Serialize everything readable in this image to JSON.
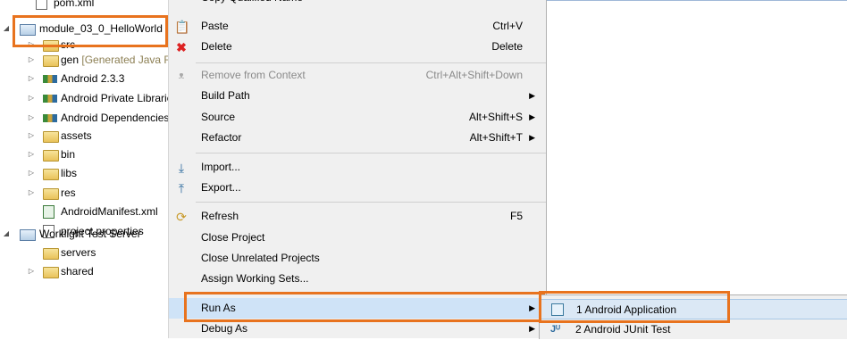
{
  "tree": {
    "items": [
      {
        "label": "pom.xml"
      },
      {
        "label": "module_03_0_HelloWorld"
      },
      {
        "label": "src"
      },
      {
        "label": "gen",
        "suffix": "[Generated Java Files]"
      },
      {
        "label": "Android 2.3.3"
      },
      {
        "label": "Android Private Libraries"
      },
      {
        "label": "Android Dependencies"
      },
      {
        "label": "assets"
      },
      {
        "label": "bin"
      },
      {
        "label": "libs"
      },
      {
        "label": "res"
      },
      {
        "label": "AndroidManifest.xml"
      },
      {
        "label": "project.properties"
      },
      {
        "label": "Worklight Test Server"
      },
      {
        "label": "servers"
      },
      {
        "label": "shared"
      }
    ]
  },
  "menu": {
    "top_partial": "Copy Qualified Name",
    "items": [
      {
        "label": "Paste",
        "accel": "Ctrl+V"
      },
      {
        "label": "Delete",
        "accel": "Delete"
      },
      {
        "label": "Remove from Context",
        "accel": "Ctrl+Alt+Shift+Down"
      },
      {
        "label": "Build Path",
        "accel": ""
      },
      {
        "label": "Source",
        "accel": "Alt+Shift+S"
      },
      {
        "label": "Refactor",
        "accel": "Alt+Shift+T"
      },
      {
        "label": "Import...",
        "accel": ""
      },
      {
        "label": "Export...",
        "accel": ""
      },
      {
        "label": "Refresh",
        "accel": "F5"
      },
      {
        "label": "Close Project",
        "accel": ""
      },
      {
        "label": "Close Unrelated Projects",
        "accel": ""
      },
      {
        "label": "Assign Working Sets...",
        "accel": ""
      },
      {
        "label": "Run As",
        "accel": ""
      },
      {
        "label": "Debug As",
        "accel": ""
      }
    ]
  },
  "submenu": {
    "items": [
      {
        "label": "1 Android Application"
      },
      {
        "label": "2 Android JUnit Test"
      }
    ]
  },
  "colors": {
    "highlight": "#e8731e",
    "selection": "#cfe3f7"
  }
}
